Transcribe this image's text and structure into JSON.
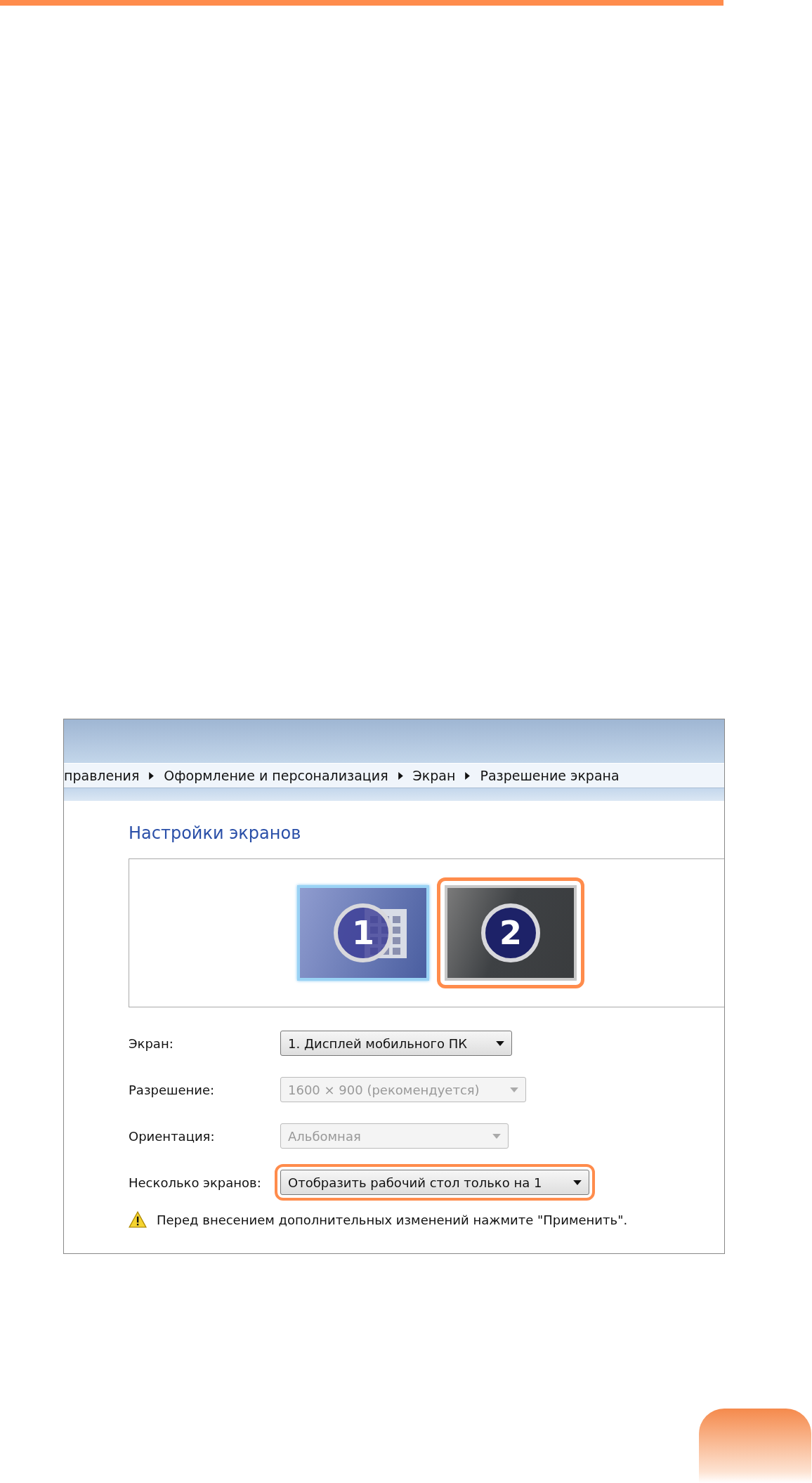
{
  "breadcrumb": [
    "правления",
    "Оформление и персонализация",
    "Экран",
    "Разрешение экрана"
  ],
  "heading": "Настройки экранов",
  "monitors": [
    {
      "number": "1",
      "selected": true,
      "highlighted": false
    },
    {
      "number": "2",
      "selected": false,
      "highlighted": true
    }
  ],
  "settings": [
    {
      "label": "Экран:",
      "value": "1. Дисплей мобильного ПК",
      "disabled": false,
      "highlighted": false
    },
    {
      "label": "Разрешение:",
      "value": "1600 × 900 (рекомендуется)",
      "disabled": true,
      "highlighted": false
    },
    {
      "label": "Ориентация:",
      "value": "Альбомная",
      "disabled": true,
      "highlighted": false
    },
    {
      "label": "Несколько экранов:",
      "value": "Отобразить рабочий стол только на 1",
      "disabled": false,
      "highlighted": true
    }
  ],
  "warning": "Перед внесением дополнительных изменений нажмите \"Применить\"."
}
